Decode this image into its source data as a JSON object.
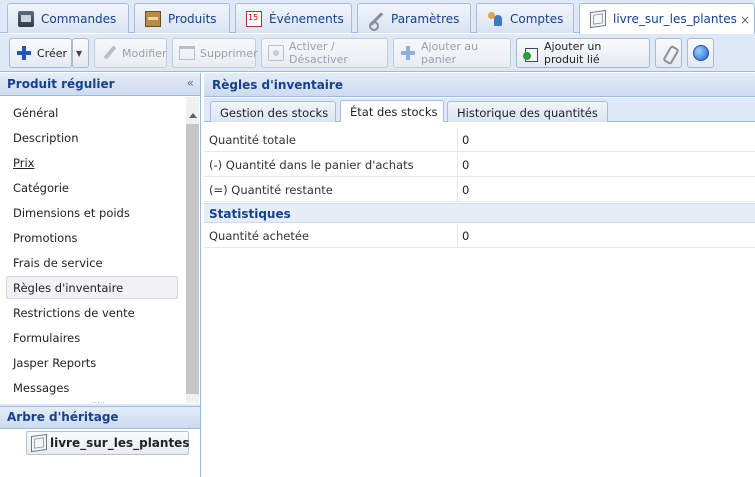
{
  "top_tabs": [
    {
      "label": "Commandes",
      "icon": "orders-icon"
    },
    {
      "label": "Produits",
      "icon": "box-icon"
    },
    {
      "label": "Événements",
      "icon": "calendar-icon"
    },
    {
      "label": "Paramètres",
      "icon": "wrench-icon"
    },
    {
      "label": "Comptes",
      "icon": "users-icon"
    },
    {
      "label": "livre_sur_les_plantes",
      "icon": "cube-icon",
      "active": true
    }
  ],
  "close_glyph": "×",
  "toolbar": {
    "create": "Créer",
    "modify": "Modifier",
    "delete": "Supprimer",
    "toggle": "Activer / Désactiver",
    "add_to_cart": "Ajouter au panier",
    "add_linked": "Ajouter un produit lié"
  },
  "left_panel": {
    "title": "Produit régulier",
    "collapse_glyph": "«",
    "items": [
      "Général",
      "Description",
      "Prix",
      "Catégorie",
      "Dimensions et poids",
      "Promotions",
      "Frais de service",
      "Règles d'inventaire",
      "Restrictions de vente",
      "Formulaires",
      "Jasper Reports",
      "Messages"
    ],
    "active_index": 7,
    "tree_title": "Arbre d'héritage",
    "tree_node": "livre_sur_les_plantes"
  },
  "right_panel": {
    "title": "Règles d'inventaire",
    "tabs": [
      "Gestion des stocks",
      "État des stocks",
      "Historique des quantités"
    ],
    "active_tab": 1,
    "rows": [
      {
        "label": "Quantité totale",
        "value": "0"
      },
      {
        "label": "(-) Quantité dans le panier d'achats",
        "value": "0"
      },
      {
        "label": "(=) Quantité restante",
        "value": "0"
      }
    ],
    "stats_title": "Statistiques",
    "stats_rows": [
      {
        "label": "Quantité achetée",
        "value": "0"
      }
    ]
  },
  "colors": {
    "header_blue": "#15428b",
    "panel_bg": "#dfe8f6",
    "border": "#99bbe8"
  }
}
